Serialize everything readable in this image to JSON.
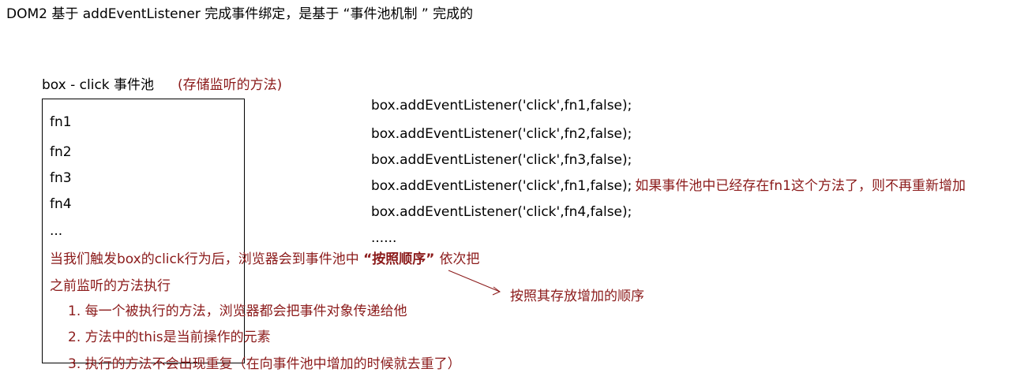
{
  "heading": "DOM2 基于 addEventListener  完成事件绑定，是基于 “事件池机制 ” 完成的",
  "pool": {
    "label": "box - click  事件池",
    "note": "(存储监听的方法)",
    "items": [
      "fn1",
      "fn2",
      "fn3",
      "fn4",
      "..."
    ]
  },
  "code": {
    "lines": [
      "box.addEventListener('click',fn1,false);",
      "box.addEventListener('click',fn2,false);",
      "box.addEventListener('click',fn3,false);",
      "box.addEventListener('click',fn1,false);",
      "box.addEventListener('click',fn4,false);",
      "......"
    ],
    "dup_note": "如果事件池中已经存在fn1这个方法了，则不再重新增加"
  },
  "explanation": {
    "line1_pre": "当我们触发box的click行为后，浏览器会到事件池中 ",
    "line1_bold": "“按照顺序”",
    "line1_post": "依次把",
    "line2": "之前监听的方法执行",
    "points": [
      "1. 每一个被执行的方法，浏览器都会把事件对象传递给他",
      "2. 方法中的this是当前操作的元素",
      "3. 执行的方法不会出现重复（在向事件池中增加的时候就去重了）"
    ]
  },
  "arrow_note": "按照其存放增加的顺序",
  "colors": {
    "accent": "#8b1a1a",
    "text": "#000000"
  }
}
